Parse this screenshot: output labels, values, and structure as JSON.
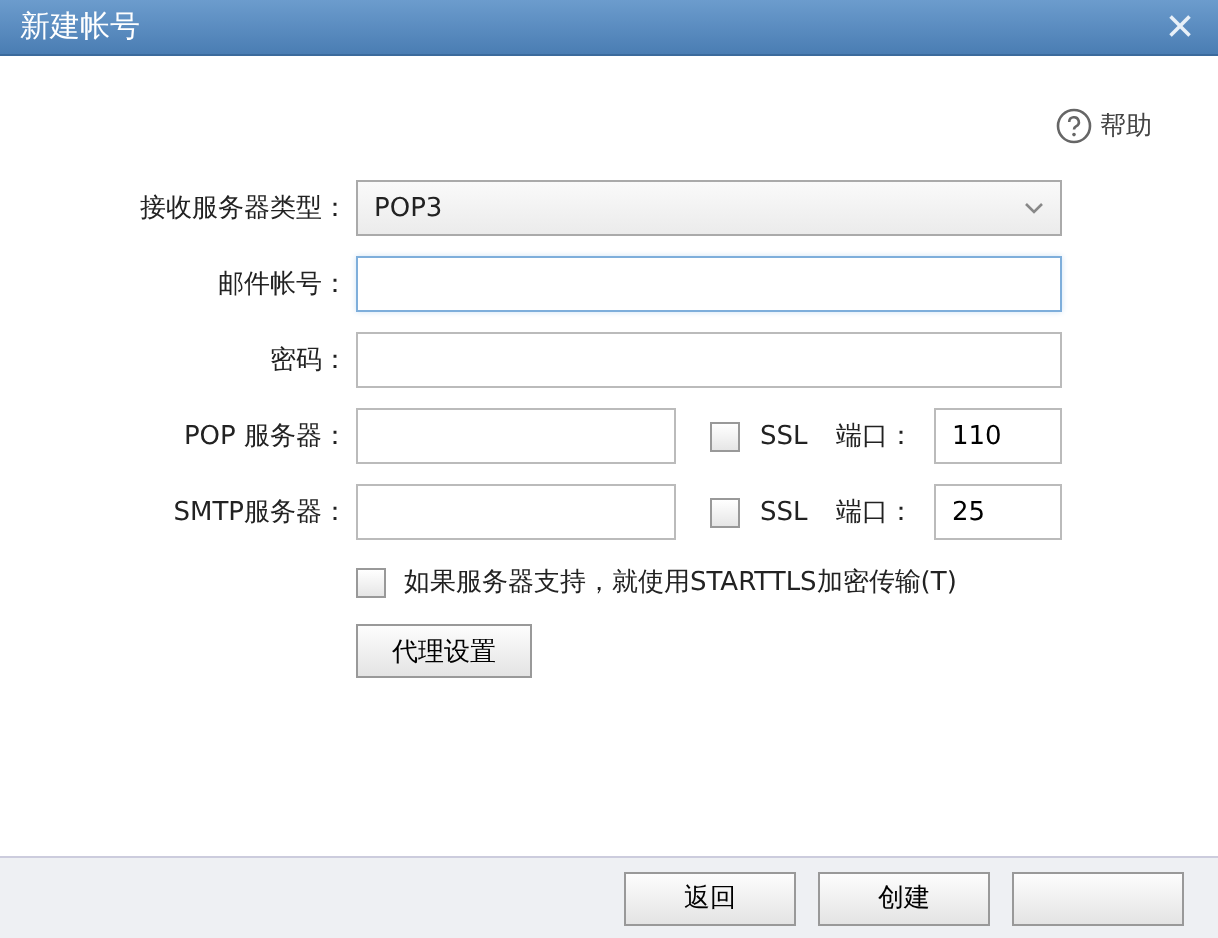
{
  "window": {
    "title": "新建帐号",
    "close": "×"
  },
  "help": {
    "label": "帮助"
  },
  "form": {
    "server_type": {
      "label": "接收服务器类型：",
      "value": "POP3"
    },
    "account": {
      "label": "邮件帐号：",
      "focused": true
    },
    "password": {
      "label": "密码："
    },
    "servers": [
      {
        "label": "POP 服务器：",
        "ssl_label": "SSL",
        "ssl_checked": false,
        "port_label": "端口：",
        "port": "110"
      },
      {
        "label": "SMTP服务器：",
        "ssl_label": "SSL",
        "ssl_checked": false,
        "port_label": "端口：",
        "port": "25"
      }
    ],
    "starttls": {
      "label": "如果服务器支持，就使用STARTTLS加密传输(T)",
      "checked": false
    },
    "proxy_button": "代理设置"
  },
  "footer": {
    "buttons": [
      {
        "kind": "labeled",
        "label": "返回"
      },
      {
        "kind": "labeled",
        "label": "创建"
      },
      {
        "kind": "covered"
      }
    ]
  }
}
